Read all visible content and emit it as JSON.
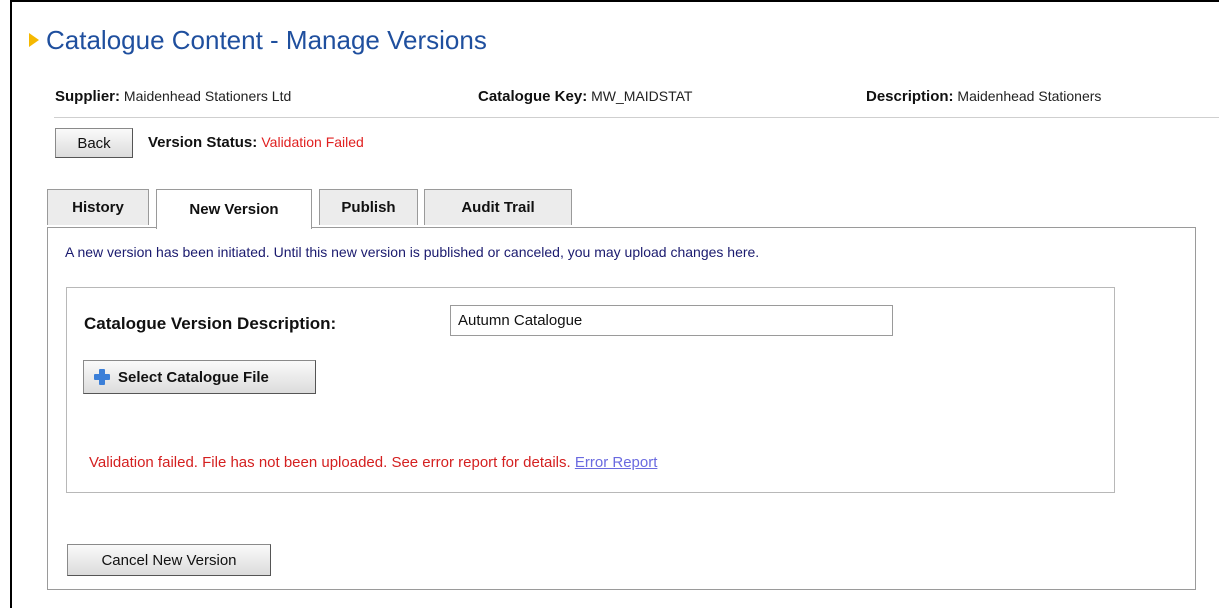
{
  "page": {
    "title": "Catalogue Content - Manage Versions"
  },
  "info": {
    "supplier_label": "Supplier:",
    "supplier_value": "Maidenhead Stationers Ltd",
    "catalogue_key_label": "Catalogue Key:",
    "catalogue_key_value": "MW_MAIDSTAT",
    "description_label": "Description:",
    "description_value": "Maidenhead Stationers"
  },
  "actions": {
    "back_label": "Back"
  },
  "status": {
    "label": "Version Status:",
    "value": "Validation Failed"
  },
  "tabs": [
    {
      "label": "History",
      "active": false
    },
    {
      "label": "New Version",
      "active": true
    },
    {
      "label": "Publish",
      "active": false
    },
    {
      "label": "Audit Trail",
      "active": false
    }
  ],
  "new_version": {
    "intro": "A new version has been initiated. Until this new version is published or canceled, you may upload changes here.",
    "description_label": "Catalogue Version Description:",
    "description_value": "Autumn Catalogue",
    "select_file_label": "Select Catalogue File",
    "error_message": "Validation failed. File has not been uploaded. See error report for details.",
    "error_link": "Error Report",
    "cancel_label": "Cancel New Version"
  },
  "colors": {
    "title": "#1f4f9e",
    "error": "#d42020",
    "link": "#6a6ae0",
    "accent_arrow": "#f5b800",
    "plus_icon": "#3b7fd8"
  },
  "icons": {
    "title_marker": "triangle-right-icon",
    "select_file": "plus-icon"
  }
}
